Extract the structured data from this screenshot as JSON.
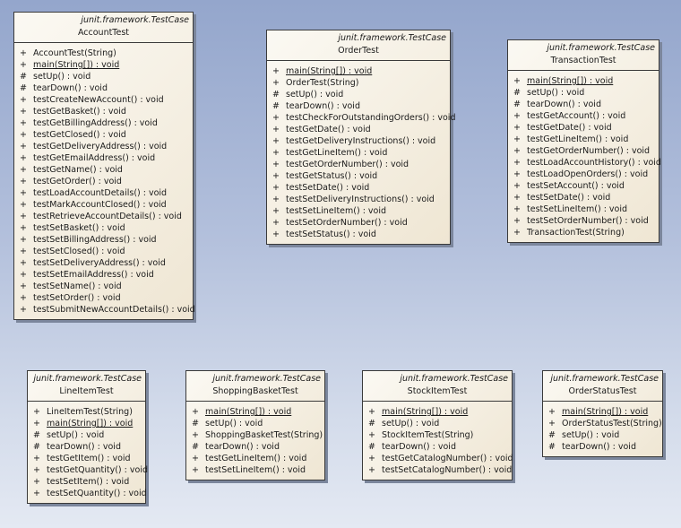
{
  "classes": [
    {
      "id": "account-test",
      "stereotype": "junit.framework.TestCase",
      "name": "AccountTest",
      "operations": [
        {
          "vis": "+",
          "text": "AccountTest(String)",
          "static": false
        },
        {
          "vis": "+",
          "text": "main(String[]) : void",
          "static": true
        },
        {
          "vis": "#",
          "text": "setUp() : void",
          "static": false
        },
        {
          "vis": "#",
          "text": "tearDown() : void",
          "static": false
        },
        {
          "vis": "+",
          "text": "testCreateNewAccount() : void",
          "static": false
        },
        {
          "vis": "+",
          "text": "testGetBasket() : void",
          "static": false
        },
        {
          "vis": "+",
          "text": "testGetBillingAddress() : void",
          "static": false
        },
        {
          "vis": "+",
          "text": "testGetClosed() : void",
          "static": false
        },
        {
          "vis": "+",
          "text": "testGetDeliveryAddress() : void",
          "static": false
        },
        {
          "vis": "+",
          "text": "testGetEmailAddress() : void",
          "static": false
        },
        {
          "vis": "+",
          "text": "testGetName() : void",
          "static": false
        },
        {
          "vis": "+",
          "text": "testGetOrder() : void",
          "static": false
        },
        {
          "vis": "+",
          "text": "testLoadAccountDetails() : void",
          "static": false
        },
        {
          "vis": "+",
          "text": "testMarkAccountClosed() : void",
          "static": false
        },
        {
          "vis": "+",
          "text": "testRetrieveAccountDetails() : void",
          "static": false
        },
        {
          "vis": "+",
          "text": "testSetBasket() : void",
          "static": false
        },
        {
          "vis": "+",
          "text": "testSetBillingAddress() : void",
          "static": false
        },
        {
          "vis": "+",
          "text": "testSetClosed() : void",
          "static": false
        },
        {
          "vis": "+",
          "text": "testSetDeliveryAddress() : void",
          "static": false
        },
        {
          "vis": "+",
          "text": "testSetEmailAddress() : void",
          "static": false
        },
        {
          "vis": "+",
          "text": "testSetName() : void",
          "static": false
        },
        {
          "vis": "+",
          "text": "testSetOrder() : void",
          "static": false
        },
        {
          "vis": "+",
          "text": "testSubmitNewAccountDetails() : void",
          "static": false
        }
      ]
    },
    {
      "id": "order-test",
      "stereotype": "junit.framework.TestCase",
      "name": "OrderTest",
      "operations": [
        {
          "vis": "+",
          "text": "main(String[]) : void",
          "static": true
        },
        {
          "vis": "+",
          "text": "OrderTest(String)",
          "static": false
        },
        {
          "vis": "#",
          "text": "setUp() : void",
          "static": false
        },
        {
          "vis": "#",
          "text": "tearDown() : void",
          "static": false
        },
        {
          "vis": "+",
          "text": "testCheckForOutstandingOrders() : void",
          "static": false
        },
        {
          "vis": "+",
          "text": "testGetDate() : void",
          "static": false
        },
        {
          "vis": "+",
          "text": "testGetDeliveryInstructions() : void",
          "static": false
        },
        {
          "vis": "+",
          "text": "testGetLineItem() : void",
          "static": false
        },
        {
          "vis": "+",
          "text": "testGetOrderNumber() : void",
          "static": false
        },
        {
          "vis": "+",
          "text": "testGetStatus() : void",
          "static": false
        },
        {
          "vis": "+",
          "text": "testSetDate() : void",
          "static": false
        },
        {
          "vis": "+",
          "text": "testSetDeliveryInstructions() : void",
          "static": false
        },
        {
          "vis": "+",
          "text": "testSetLineItem() : void",
          "static": false
        },
        {
          "vis": "+",
          "text": "testSetOrderNumber() : void",
          "static": false
        },
        {
          "vis": "+",
          "text": "testSetStatus() : void",
          "static": false
        }
      ]
    },
    {
      "id": "transaction-test",
      "stereotype": "junit.framework.TestCase",
      "name": "TransactionTest",
      "operations": [
        {
          "vis": "+",
          "text": "main(String[]) : void",
          "static": true
        },
        {
          "vis": "#",
          "text": "setUp() : void",
          "static": false
        },
        {
          "vis": "#",
          "text": "tearDown() : void",
          "static": false
        },
        {
          "vis": "+",
          "text": "testGetAccount() : void",
          "static": false
        },
        {
          "vis": "+",
          "text": "testGetDate() : void",
          "static": false
        },
        {
          "vis": "+",
          "text": "testGetLineItem() : void",
          "static": false
        },
        {
          "vis": "+",
          "text": "testGetOrderNumber() : void",
          "static": false
        },
        {
          "vis": "+",
          "text": "testLoadAccountHistory() : void",
          "static": false
        },
        {
          "vis": "+",
          "text": "testLoadOpenOrders() : void",
          "static": false
        },
        {
          "vis": "+",
          "text": "testSetAccount() : void",
          "static": false
        },
        {
          "vis": "+",
          "text": "testSetDate() : void",
          "static": false
        },
        {
          "vis": "+",
          "text": "testSetLineItem() : void",
          "static": false
        },
        {
          "vis": "+",
          "text": "testSetOrderNumber() : void",
          "static": false
        },
        {
          "vis": "+",
          "text": "TransactionTest(String)",
          "static": false
        }
      ]
    },
    {
      "id": "line-item-test",
      "stereotype": "junit.framework.TestCase",
      "name": "LineItemTest",
      "operations": [
        {
          "vis": "+",
          "text": "LineItemTest(String)",
          "static": false
        },
        {
          "vis": "+",
          "text": "main(String[]) : void",
          "static": true
        },
        {
          "vis": "#",
          "text": "setUp() : void",
          "static": false
        },
        {
          "vis": "#",
          "text": "tearDown() : void",
          "static": false
        },
        {
          "vis": "+",
          "text": "testGetItem() : void",
          "static": false
        },
        {
          "vis": "+",
          "text": "testGetQuantity() : void",
          "static": false
        },
        {
          "vis": "+",
          "text": "testSetItem() : void",
          "static": false
        },
        {
          "vis": "+",
          "text": "testSetQuantity() : void",
          "static": false
        }
      ]
    },
    {
      "id": "shopping-basket-test",
      "stereotype": "junit.framework.TestCase",
      "name": "ShoppingBasketTest",
      "operations": [
        {
          "vis": "+",
          "text": "main(String[]) : void",
          "static": true
        },
        {
          "vis": "#",
          "text": "setUp() : void",
          "static": false
        },
        {
          "vis": "+",
          "text": "ShoppingBasketTest(String)",
          "static": false
        },
        {
          "vis": "#",
          "text": "tearDown() : void",
          "static": false
        },
        {
          "vis": "+",
          "text": "testGetLineItem() : void",
          "static": false
        },
        {
          "vis": "+",
          "text": "testSetLineItem() : void",
          "static": false
        }
      ]
    },
    {
      "id": "stock-item-test",
      "stereotype": "junit.framework.TestCase",
      "name": "StockItemTest",
      "operations": [
        {
          "vis": "+",
          "text": "main(String[]) : void",
          "static": true
        },
        {
          "vis": "#",
          "text": "setUp() : void",
          "static": false
        },
        {
          "vis": "+",
          "text": "StockItemTest(String)",
          "static": false
        },
        {
          "vis": "#",
          "text": "tearDown() : void",
          "static": false
        },
        {
          "vis": "+",
          "text": "testGetCatalogNumber() : void",
          "static": false
        },
        {
          "vis": "+",
          "text": "testSetCatalogNumber() : void",
          "static": false
        }
      ]
    },
    {
      "id": "order-status-test",
      "stereotype": "junit.framework.TestCase",
      "name": "OrderStatusTest",
      "operations": [
        {
          "vis": "+",
          "text": "main(String[]) : void",
          "static": true
        },
        {
          "vis": "+",
          "text": "OrderStatusTest(String)",
          "static": false
        },
        {
          "vis": "#",
          "text": "setUp() : void",
          "static": false
        },
        {
          "vis": "#",
          "text": "tearDown() : void",
          "static": false
        }
      ]
    }
  ]
}
